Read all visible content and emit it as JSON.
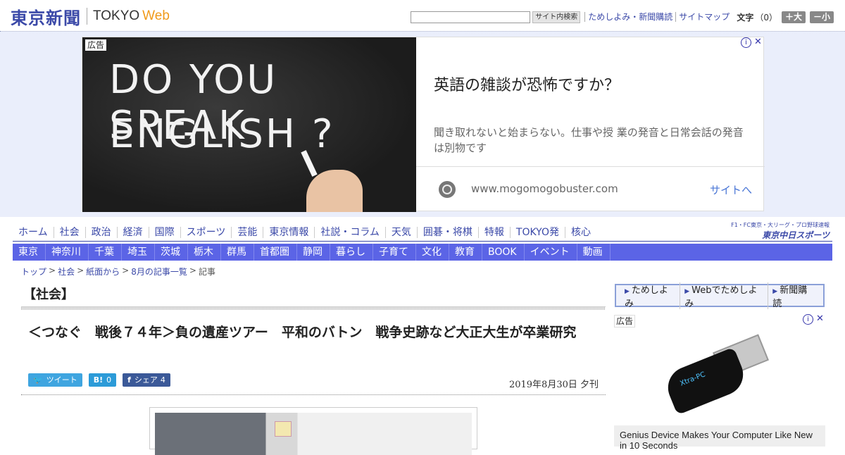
{
  "header": {
    "logo_jp": "東京新聞",
    "logo_tokyo": "TOKYO",
    "logo_web": "Web",
    "search_placeholder": "",
    "search_button": "サイト内検索",
    "links": [
      "ためしよみ・新聞購読",
      "サイトマップ"
    ],
    "font_label": "文字",
    "font_count": "（0）",
    "font_plus": "＋大",
    "font_minus": "－小"
  },
  "ad_banner": {
    "label": "広告",
    "chalk_line1": "DO YOU SPEAK",
    "chalk_line2": "ENGLISH ?",
    "title": "英語の雑談が恐怖ですか？",
    "description": "聞き取れないと始まらない。仕事や授 業の発音と日常会話の発音は別物です",
    "url": "www.mogomogobuster.com",
    "cta": "サイトへ",
    "info_glyph": "i",
    "close_glyph": "✕"
  },
  "nav_primary": [
    "ホーム",
    "社会",
    "政治",
    "経済",
    "国際",
    "スポーツ",
    "芸能",
    "東京情報",
    "社説・コラム",
    "天気",
    "囲碁・将棋",
    "特報",
    "TOKYO発",
    "核心"
  ],
  "chunichi": {
    "top": "F1・FC東京・大リーグ・プロ野球速報",
    "bottom": "東京中日スポーツ"
  },
  "nav_secondary": [
    "東京",
    "神奈川",
    "千葉",
    "埼玉",
    "茨城",
    "栃木",
    "群馬",
    "首都圏",
    "静岡",
    "暮らし",
    "子育て",
    "文化",
    "教育",
    "BOOK",
    "イベント",
    "動画"
  ],
  "breadcrumb": {
    "items": [
      "トップ",
      "社会",
      "紙面から",
      "8月の記事一覧"
    ],
    "current": "記事",
    "separator": ">"
  },
  "article": {
    "section": "【社会】",
    "headline": "＜つなぐ　戦後７４年＞負の遺産ツアー　平和のバトン　戦争史跡など大正大生が卒業研究",
    "share": {
      "tweet_icon": "🐦",
      "tweet": "ツイート",
      "hatena_icon": "B!",
      "hatena_count": "0",
      "fb_icon": "f",
      "fb_label": "シェア",
      "fb_count": "4"
    },
    "date": "2019年8月30日 夕刊"
  },
  "sidebar": {
    "promo_items": [
      "ためしよみ",
      "Webでためしよみ",
      "新聞購読"
    ],
    "ad_label": "広告",
    "ad_caption": "Genius Device Makes Your Computer Like New in 10 Seconds",
    "usb_brand": "Xtra-PC"
  },
  "colors": {
    "brand": "#3b49a8",
    "web_accent": "#f09a1a",
    "nav_bar": "#5b64e6",
    "ad_band": "#eaeefb"
  }
}
